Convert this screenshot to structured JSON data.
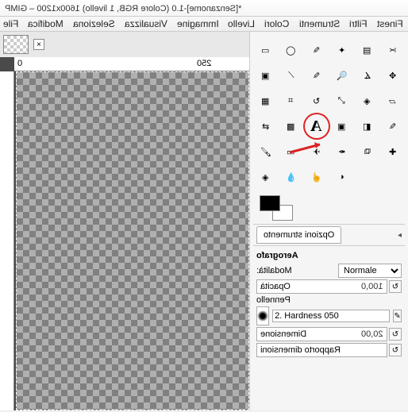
{
  "title": "*[Senzanome]-1.0 (Colore RGB, 1 livello) 1600x1200 – GIMP",
  "menu": [
    "File",
    "Modifica",
    "Seleziona",
    "Visualizza",
    "Immagine",
    "Livello",
    "Colori",
    "Strumenti",
    "Filtri",
    "Finest"
  ],
  "ruler": {
    "zero": "0",
    "mark250": "250"
  },
  "tools": [
    [
      "rect-select",
      "ellipse-select",
      "free-select",
      "fuzzy-select",
      "by-color-select",
      "scissors"
    ],
    [
      "foreground-select",
      "paths",
      "color-picker",
      "zoom",
      "measure",
      "move"
    ],
    [
      "align",
      "crop",
      "rotate",
      "scale",
      "shear",
      "perspective"
    ],
    [
      "flip",
      "cage",
      "text",
      "bucket-fill",
      "blend",
      "pencil"
    ],
    [
      "paintbrush",
      "eraser",
      "airbrush",
      "ink",
      "clone",
      "heal"
    ],
    [
      "perspective-clone",
      "blur",
      "smudge",
      "dodge",
      "",
      ""
    ]
  ],
  "tool_glyphs": {
    "rect-select": "▭",
    "ellipse-select": "◯",
    "free-select": "✎",
    "fuzzy-select": "✦",
    "by-color-select": "▤",
    "scissors": "✂",
    "foreground-select": "▣",
    "paths": "⟋",
    "color-picker": "✎",
    "zoom": "🔍",
    "measure": "∡",
    "move": "✥",
    "align": "▦",
    "crop": "⌗",
    "rotate": "↻",
    "scale": "⤢",
    "shear": "◈",
    "perspective": "▱",
    "flip": "⇄",
    "cage": "▩",
    "text": "A",
    "bucket-fill": "▣",
    "blend": "◧",
    "pencil": "✎",
    "paintbrush": "🖌",
    "eraser": "▭",
    "airbrush": "✈",
    "ink": "✒",
    "clone": "⧉",
    "heal": "✚",
    "perspective-clone": "◈",
    "blur": "💧",
    "smudge": "☝",
    "dodge": "◐"
  },
  "options_tab": "Opzioni strumento",
  "options": {
    "title": "Aerografo",
    "mode_label": "Modalità:",
    "mode_value": "Normale",
    "opacity_label": "Opacità",
    "opacity_value": "100,0",
    "brush_label": "Pennello",
    "brush_name": "2. Hardness 050",
    "size_label": "Dimensione",
    "size_value": "20,00",
    "ratio_label": "Rapporto dimensioni"
  }
}
